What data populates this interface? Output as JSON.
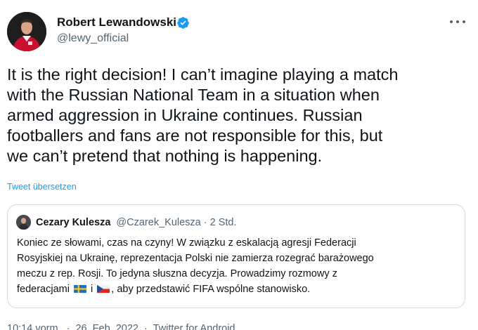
{
  "author": {
    "name": "Robert Lewandowski",
    "handle": "@lewy_official",
    "verified": true
  },
  "tweet": {
    "lines": [
      "It is the right decision!  I can’t imagine playing a match",
      "with the Russian National Team in a situation when",
      "armed aggression in Ukraine continues.  Russian",
      "footballers and fans are not responsible for this, but",
      "we can’t pretend that nothing is happening."
    ],
    "translate_label": "Tweet übersetzen"
  },
  "quote": {
    "name": "Cezary Kulesza",
    "handle": "@Czarek_Kulesza",
    "separator": "·",
    "time": "2 Std.",
    "lines": [
      "Koniec ze słowami, czas na czyny! W związku z eskalacją agresji Federacji",
      "Rosyjskiej na Ukrainę, reprezentacja Polski nie zamierza rozegrać barażowego",
      "meczu z rep. Rosji. To jedyna słuszna decyzja. Prowadzimy rozmowy z"
    ],
    "last_line_before": "federacjami",
    "last_line_joiner": "i",
    "last_line_after": ", aby przedstawić FIFA wspólne stanowisko.",
    "flags": [
      "flag-sweden",
      "flag-czech-republic"
    ]
  },
  "meta": {
    "time": "10:14 vorm.",
    "separator": "·",
    "date": "26. Feb. 2022",
    "source": "Twitter for Android"
  },
  "colors": {
    "text": "#0f1419",
    "secondary": "#536471",
    "link": "#1d9bf0",
    "verified": "#1d9bf0",
    "border": "#cfd9de"
  }
}
